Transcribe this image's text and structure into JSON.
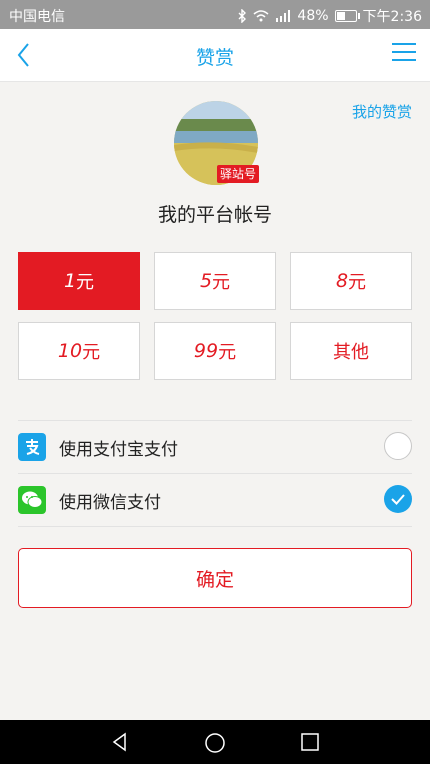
{
  "status": {
    "carrier": "中国电信",
    "battery": "48%",
    "battery_level": 0.48,
    "time": "下午2:36"
  },
  "nav": {
    "title": "赞赏"
  },
  "my_reward_link": "我的赞赏",
  "profile": {
    "badge": "驿站号",
    "account_name": "我的平台帐号"
  },
  "amounts": [
    {
      "num": "1",
      "unit": "元",
      "selected": true
    },
    {
      "num": "5",
      "unit": "元",
      "selected": false
    },
    {
      "num": "8",
      "unit": "元",
      "selected": false
    },
    {
      "num": "10",
      "unit": "元",
      "selected": false
    },
    {
      "num": "99",
      "unit": "元",
      "selected": false
    },
    {
      "num": "",
      "unit": "其他",
      "selected": false
    }
  ],
  "payment_methods": [
    {
      "label": "使用支付宝支付",
      "icon": "alipay-icon",
      "color": "#1aa3e8",
      "checked": false
    },
    {
      "label": "使用微信支付",
      "icon": "wechat-icon",
      "color": "#2bc52b",
      "checked": true
    }
  ],
  "confirm_label": "确定",
  "colors": {
    "accent_blue": "#1aa3e8",
    "accent_red": "#e31b23"
  }
}
